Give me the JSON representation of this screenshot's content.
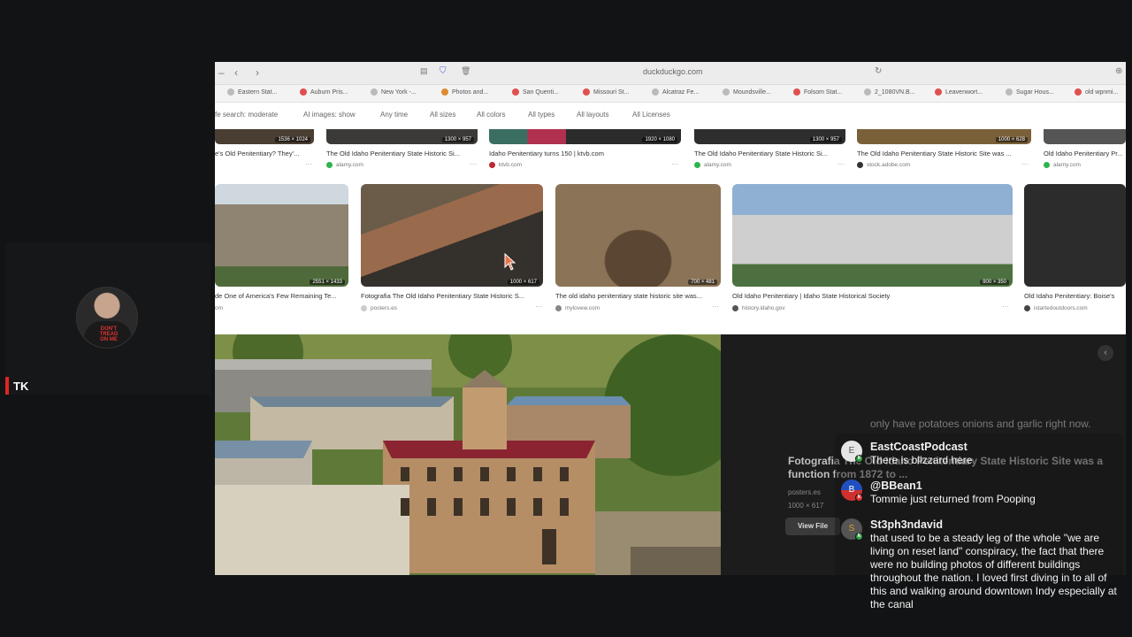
{
  "participant": {
    "name": "TK",
    "shirt_text": "DON'T TREAD ON ME"
  },
  "browser": {
    "url": "duckduckgo.com"
  },
  "bookmarks": [
    "Eastern Stat...",
    "Auburn Pris...",
    "New York -...",
    "Photos and...",
    "San Quenti...",
    "Missouri St...",
    "Alcatraz Fe...",
    "Moundsville...",
    "Folsom Stat...",
    "2_1080VN.B...",
    "Leavenwort...",
    "Sugar Hous...",
    "old wpnmi..."
  ],
  "filters": [
    "fe search: moderate",
    "AI images: show",
    "Any time",
    "All sizes",
    "All colors",
    "All types",
    "All layouts",
    "All Licenses"
  ],
  "row1": [
    {
      "dims": "1536 × 1024",
      "caption": "e's Old Penitentiary? They'...",
      "source": "alamy.com"
    },
    {
      "dims": "1300 × 957",
      "caption": "The Old Idaho Penitentiary State Historic Si...",
      "source": "alamy.com"
    },
    {
      "dims": "1920 × 1080",
      "caption": "Idaho Penitentiary turns 150 | ktvb.com",
      "source": "ktvb.com"
    },
    {
      "dims": "1300 × 957",
      "caption": "The Old Idaho Penitentiary State Historic Si...",
      "source": "alamy.com"
    },
    {
      "dims": "1000 × 628",
      "caption": "The Old Idaho Penitentiary State Historic Site was ...",
      "source": "stock.adobe.com"
    },
    {
      "dims": "",
      "caption": "Old Idaho Penitentiary Pr...",
      "source": "alamy.com"
    }
  ],
  "row2": [
    {
      "dims": "2551 × 1433",
      "caption": "de One of America's Few Remaining Te...",
      "source": "om"
    },
    {
      "dims": "1000 × 617",
      "caption": "Fotografia The Old Idaho Penitentiary State Historic S...",
      "source": "posters.es"
    },
    {
      "dims": "700 × 481",
      "caption": "The old idaho penitentiary state historic site was...",
      "source": "mylovew.com"
    },
    {
      "dims": "900 × 350",
      "caption": "Old Idaho Penitentiary | Idaho State Historical Society",
      "source": "history.idaho.gov"
    },
    {
      "dims": "",
      "caption": "Old Idaho Penitentiary: Boise's",
      "source": "istartedoutdoors.com"
    }
  ],
  "detail": {
    "title": "Fotografia The Old Idaho Penitentiary State Historic Site was a function from 1872 to ...",
    "source": "posters.es",
    "dims": "1000 × 617",
    "view_button": "View File"
  },
  "chat": {
    "previous": "only have potatoes onions and garlic right now.",
    "messages": [
      {
        "user": "EastCoastPodcast",
        "text": "There is blizzard here",
        "avatar_letter": "E"
      },
      {
        "user": "@BBean1",
        "text": "Tommie just returned from Pooping",
        "avatar_letter": "B"
      },
      {
        "user": "St3ph3ndavid",
        "text": "that used to be a steady leg of the whole \"we are living on reset land\" conspiracy, the fact that there were no building photos of different buildings throughout the nation. I loved first diving in to all of this and walking around downtown Indy especially at the canal",
        "avatar_letter": "S"
      }
    ]
  },
  "colors": {
    "name_bar": "#e02424",
    "online_badge": "#2ea043"
  }
}
